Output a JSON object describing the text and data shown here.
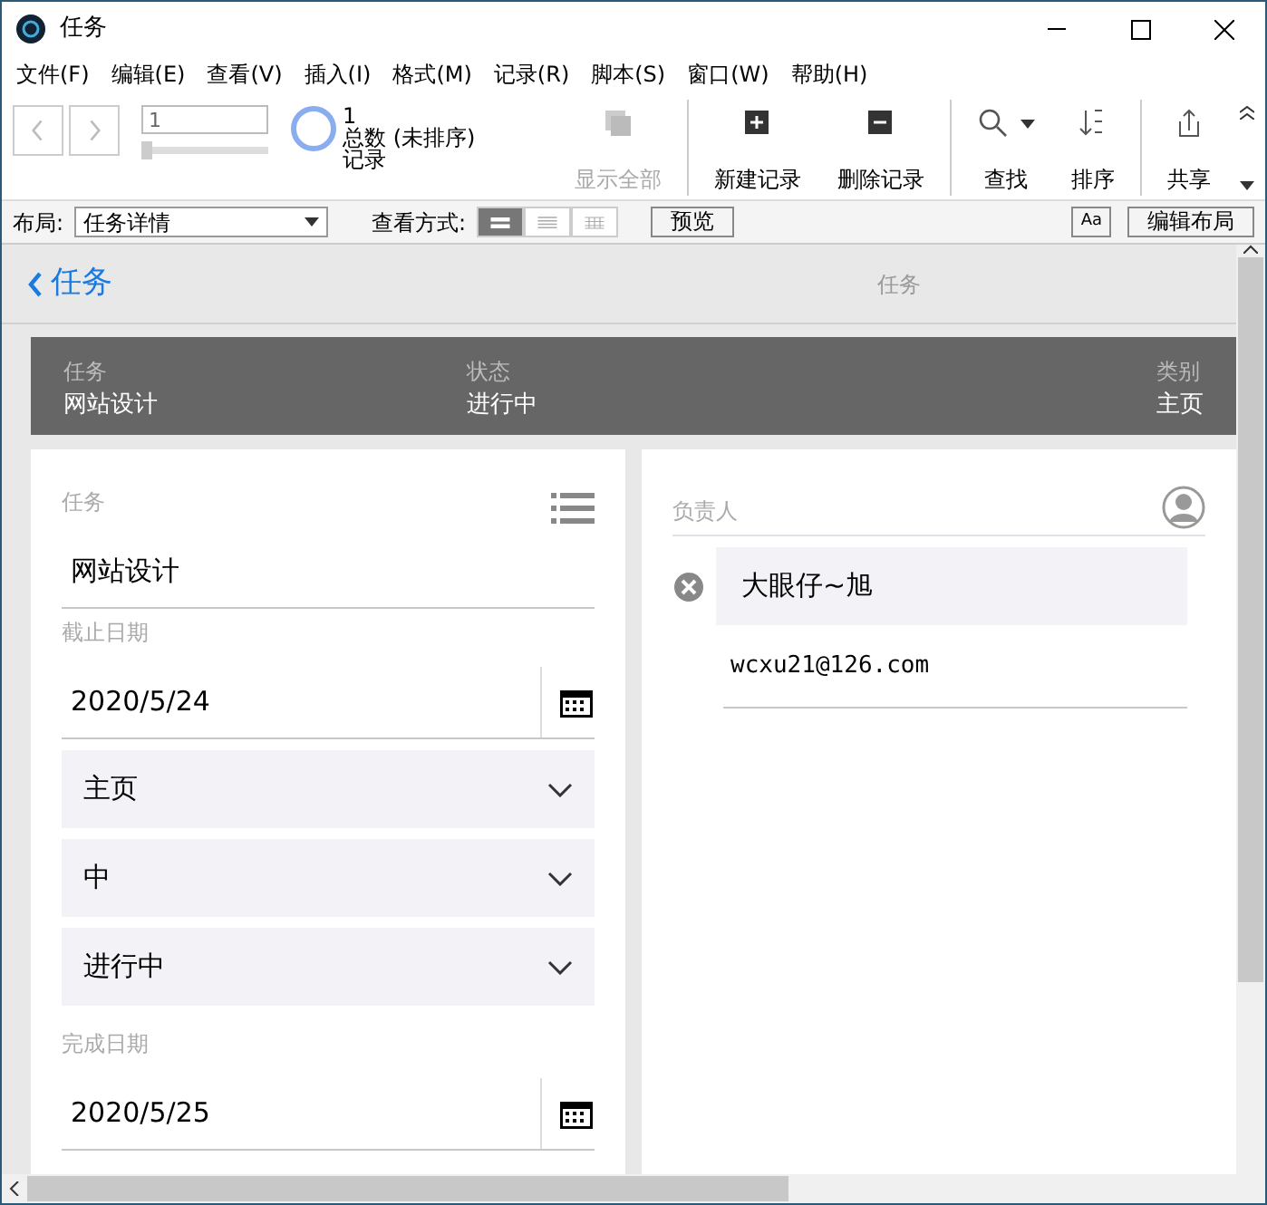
{
  "window": {
    "title": "任务"
  },
  "menu": [
    "文件(F)",
    "编辑(E)",
    "查看(V)",
    "插入(I)",
    "格式(M)",
    "记录(R)",
    "脚本(S)",
    "窗口(W)",
    "帮助(H)"
  ],
  "toolbar": {
    "record_value": "1",
    "level": 0,
    "found": "1",
    "total": "总数 (未排序)",
    "unit": "记录",
    "buttons": [
      {
        "kind": "show-all",
        "label": "显示全部",
        "disabled": true
      },
      {
        "kind": "new",
        "label": "新建记录",
        "disabled": false
      },
      {
        "kind": "delete",
        "label": "删除记录",
        "disabled": false
      },
      {
        "kind": "find",
        "label": "查找",
        "disabled": false
      },
      {
        "kind": "sort",
        "label": "排序",
        "disabled": false
      },
      {
        "kind": "share",
        "label": "共享",
        "disabled": false
      }
    ]
  },
  "layout_bar": {
    "layout_label": "布局:",
    "layout": "任务详情",
    "view_label": "查看方式:",
    "views": [
      {
        "kind": "form",
        "selected": true
      },
      {
        "kind": "list",
        "selected": false
      },
      {
        "kind": "table",
        "selected": false
      }
    ],
    "preview": "预览",
    "font_button": "Aa",
    "edit_layout": "编辑布局"
  },
  "nav": {
    "back": "任务",
    "title": "任务"
  },
  "summary": [
    {
      "label": "任务",
      "value": "网站设计"
    },
    {
      "label": "状态",
      "value": "进行中"
    },
    {
      "label": "类别",
      "value": "主页"
    }
  ],
  "left_fields": [
    {
      "kind": "text",
      "label": "任务",
      "value": "网站设计"
    },
    {
      "kind": "date",
      "label": "截止日期",
      "value": "2020/5/24"
    },
    {
      "kind": "select",
      "value": "主页"
    },
    {
      "kind": "select",
      "value": "中"
    },
    {
      "kind": "select",
      "value": "进行中"
    },
    {
      "kind": "date",
      "label": "完成日期",
      "value": "2020/5/25"
    }
  ],
  "assignee": {
    "label": "负责人",
    "name": "大眼仔~旭",
    "email": "wcxu21@126.com"
  }
}
